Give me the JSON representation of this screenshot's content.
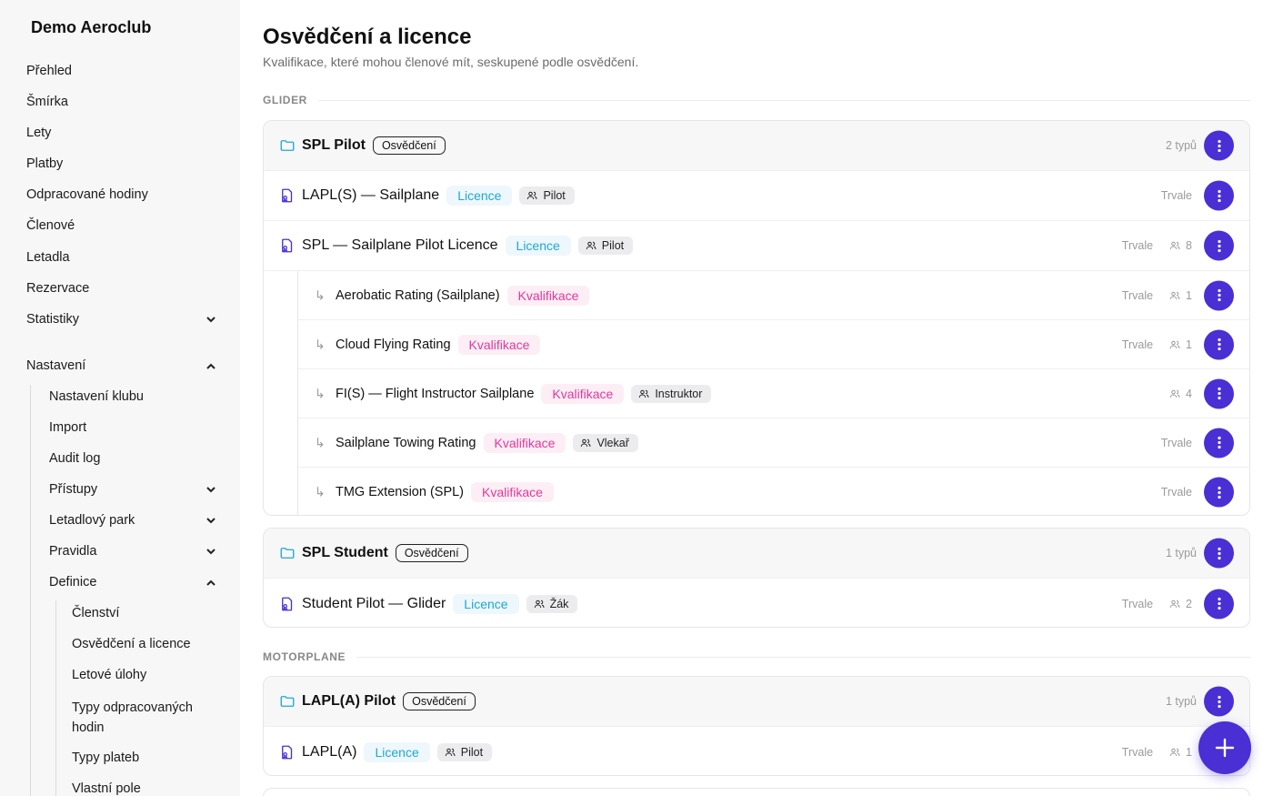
{
  "app": {
    "title": "Demo Aeroclub"
  },
  "sidebar": {
    "items": [
      {
        "label": "Přehled"
      },
      {
        "label": "Šmírka"
      },
      {
        "label": "Lety"
      },
      {
        "label": "Platby"
      },
      {
        "label": "Odpracované hodiny"
      },
      {
        "label": "Členové"
      },
      {
        "label": "Letadla"
      },
      {
        "label": "Rezervace"
      },
      {
        "label": "Statistiky"
      },
      {
        "label": "Nastavení"
      }
    ],
    "settings": [
      {
        "label": "Nastavení klubu"
      },
      {
        "label": "Import"
      },
      {
        "label": "Audit log"
      },
      {
        "label": "Přístupy"
      },
      {
        "label": "Letadlový park"
      },
      {
        "label": "Pravidla"
      },
      {
        "label": "Definice"
      }
    ],
    "definitions": [
      {
        "label": "Členství"
      },
      {
        "label": "Osvědčení a licence"
      },
      {
        "label": "Letové úlohy"
      },
      {
        "label": "Typy odpracovaných"
      },
      {
        "label": "hodin"
      },
      {
        "label": "Typy plateb"
      },
      {
        "label": "Vlastní pole"
      }
    ]
  },
  "page": {
    "title": "Osvědčení a licence",
    "subtitle": "Kvalifikace, které mohou členové mít, seskupené podle osvědčení."
  },
  "labels": {
    "osvedceni": "Osvědčení",
    "licence": "Licence",
    "kvalifikace": "Kvalifikace",
    "trvale": "Trvale"
  },
  "sections": [
    {
      "name": "GLIDER",
      "groups": [
        {
          "name": "SPL Pilot",
          "count": "2 typů",
          "items": [
            {
              "name": "LAPL(S) — Sailplane",
              "role": "Pilot",
              "members": ""
            },
            {
              "name": "SPL — Sailplane Pilot Licence",
              "role": "Pilot",
              "members": "8",
              "children": [
                {
                  "name": "Aerobatic Rating (Sailplane)",
                  "role": "",
                  "members": "1"
                },
                {
                  "name": "Cloud Flying Rating",
                  "role": "",
                  "members": "1"
                },
                {
                  "name": "FI(S) — Flight Instructor Sailplane",
                  "role": "Instruktor",
                  "members": "4"
                },
                {
                  "name": "Sailplane Towing Rating",
                  "role": "Vlekař",
                  "members": ""
                },
                {
                  "name": "TMG Extension (SPL)",
                  "role": "",
                  "members": ""
                }
              ]
            }
          ]
        },
        {
          "name": "SPL Student",
          "count": "1 typů",
          "items": [
            {
              "name": "Student Pilot — Glider",
              "role": "Žák",
              "members": "2"
            }
          ]
        }
      ]
    },
    {
      "name": "MOTORPLANE",
      "groups": [
        {
          "name": "LAPL(A) Pilot",
          "count": "1 typů",
          "items": [
            {
              "name": "LAPL(A)",
              "role": "Pilot",
              "members": "1"
            }
          ]
        }
      ]
    }
  ],
  "colors": {
    "accent": "#4a2fd4",
    "licence": "#1ca8d8",
    "kvalifikace": "#e0399b"
  },
  "icons": {
    "group": "folder-icon",
    "licence": "license-icon",
    "role": "users-icon",
    "kebab": "kebab-icon",
    "fab": "plus-icon"
  }
}
